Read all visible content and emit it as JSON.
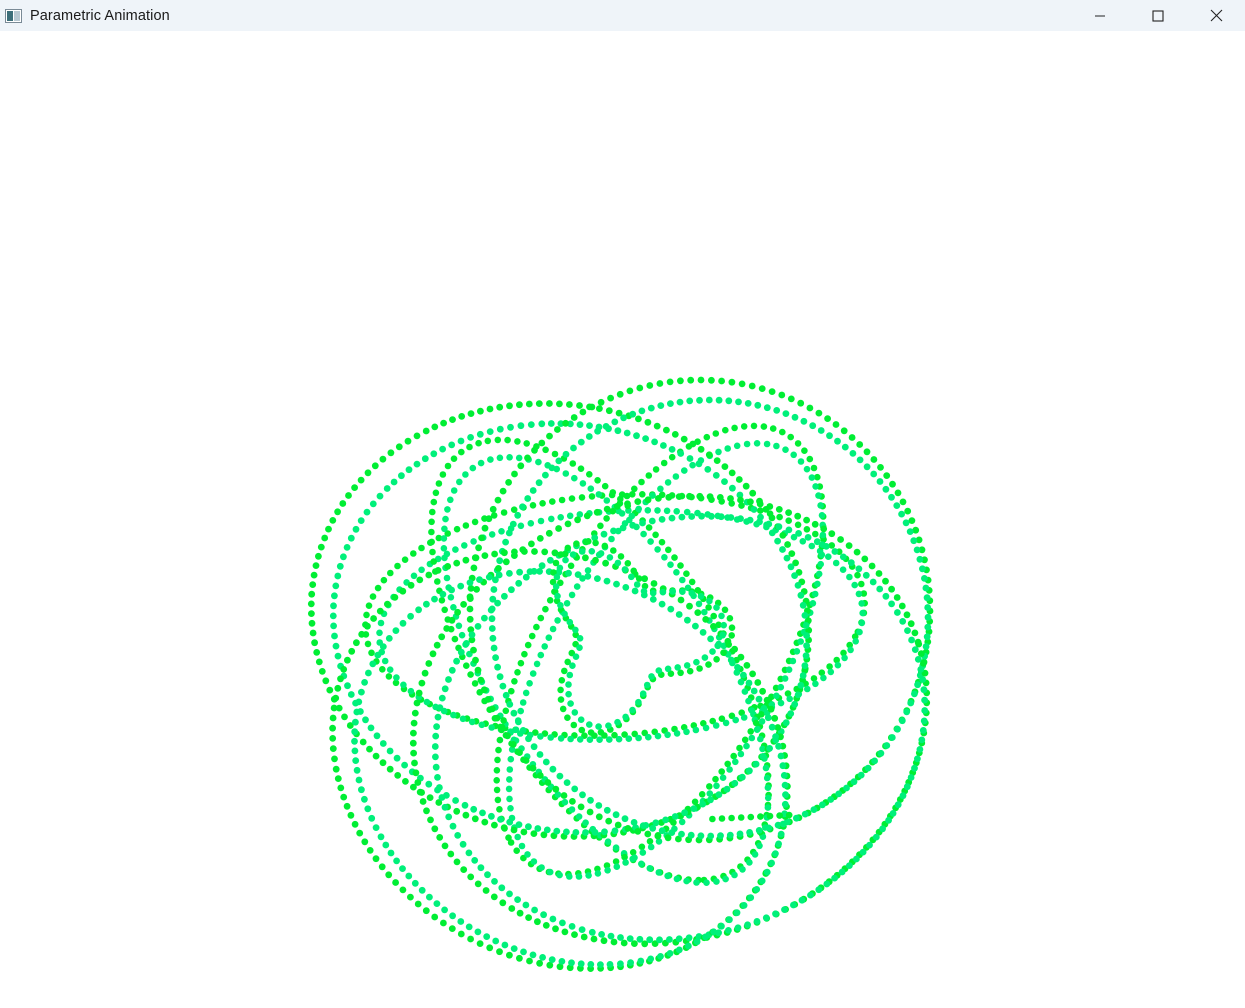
{
  "window": {
    "title": "Parametric Animation",
    "icon": "app-window-icon",
    "controls": [
      "minimize-icon",
      "maximize-icon",
      "close-icon"
    ]
  },
  "figure": {
    "background": "#ffffff",
    "dot_colors": [
      "#00ee33",
      "#00f07a"
    ],
    "dot_style": "dense dotted curve"
  }
}
